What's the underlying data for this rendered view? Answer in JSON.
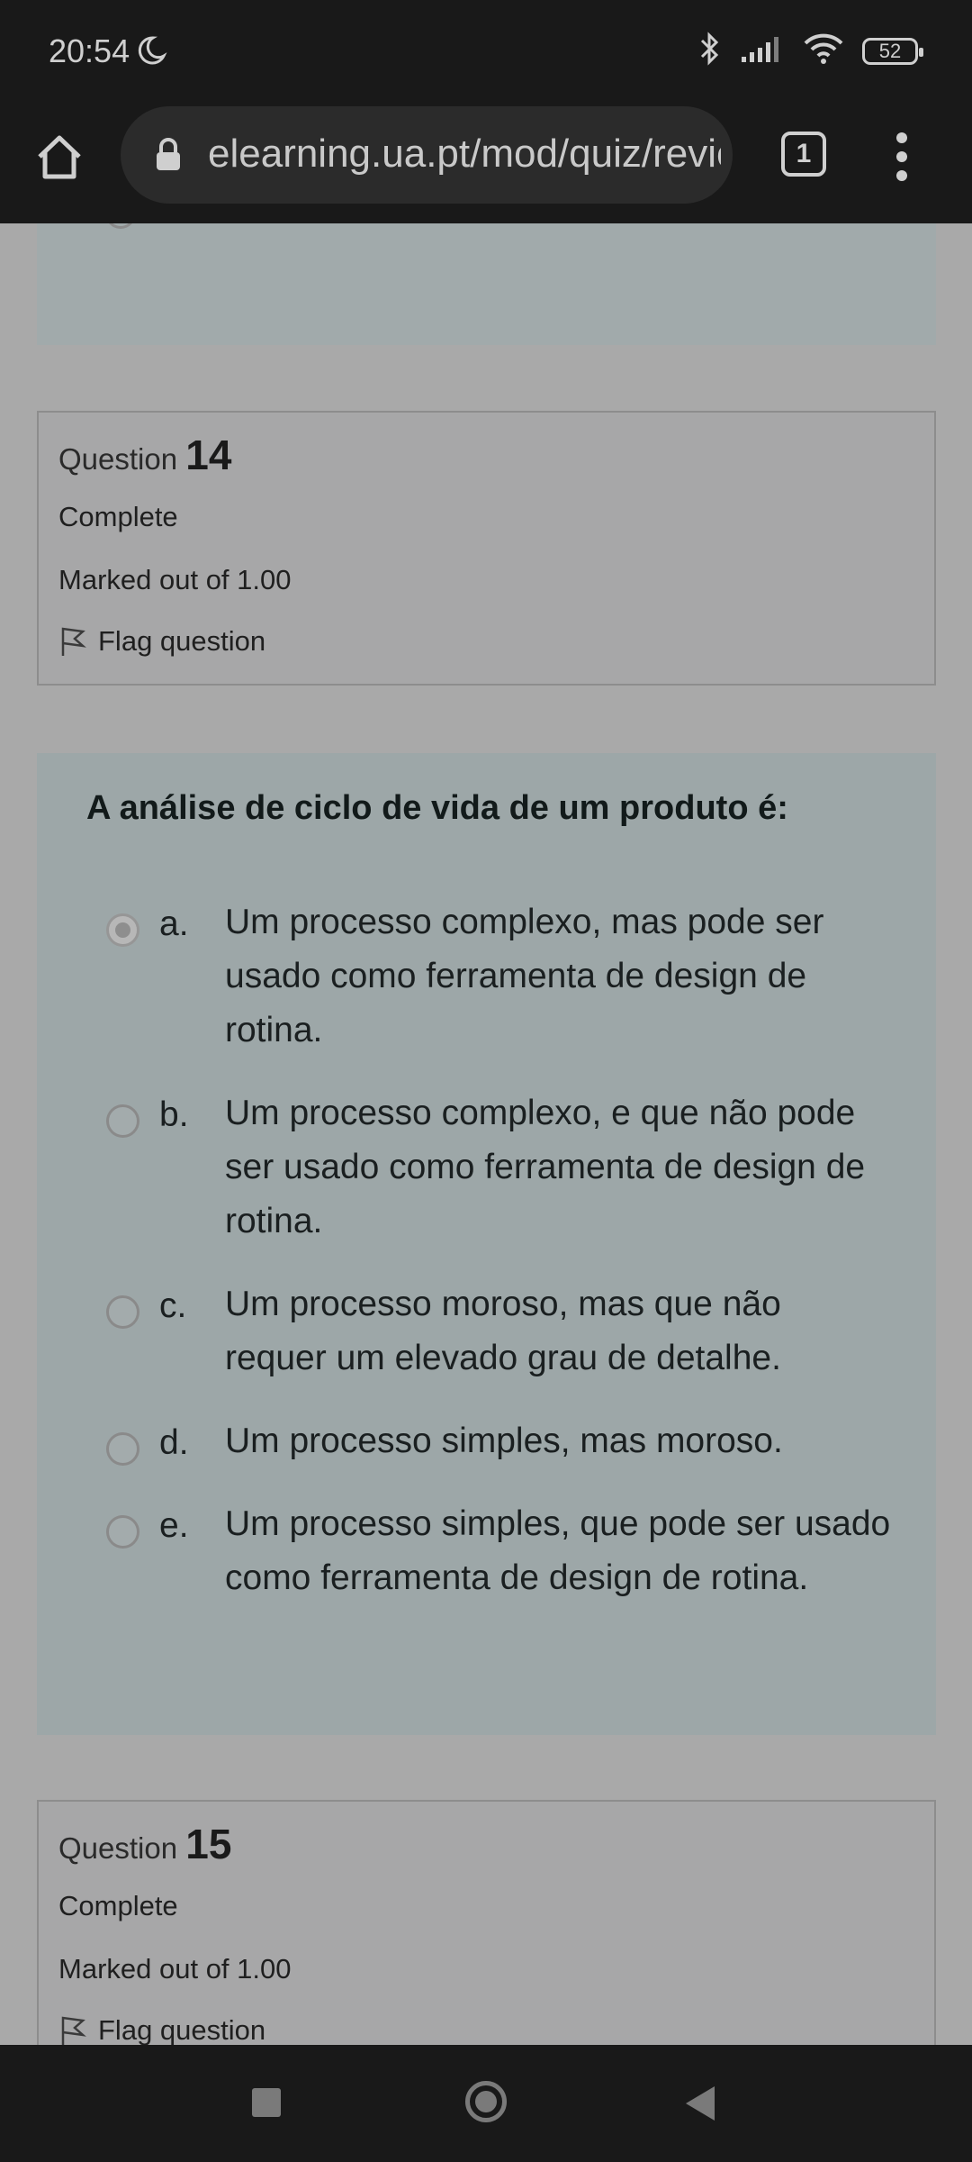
{
  "status_bar": {
    "time": "20:54",
    "battery": "52"
  },
  "browser": {
    "url": "elearning.ua.pt/mod/quiz/review.php",
    "tab_count": "1"
  },
  "question14": {
    "label": "Question",
    "number": "14",
    "state": "Complete",
    "mark": "Marked out of 1.00",
    "flag": "Flag question"
  },
  "quiz_question": {
    "text": "A análise de ciclo de vida de um produto é:",
    "selected": "a",
    "answers": [
      {
        "letter": "a.",
        "text": "Um processo complexo, mas pode ser usado como ferramenta de design de rotina."
      },
      {
        "letter": "b.",
        "text": "Um processo complexo, e que não pode ser usado como ferramenta de design de rotina."
      },
      {
        "letter": "c.",
        "text": "Um processo moroso, mas que não requer um elevado grau de detalhe."
      },
      {
        "letter": "d.",
        "text": "Um processo simples, mas moroso."
      },
      {
        "letter": "e.",
        "text": "Um processo simples, que pode ser usado como ferramenta de design de rotina."
      }
    ]
  },
  "question15": {
    "label": "Question",
    "number": "15",
    "state": "Complete",
    "mark": "Marked out of 1.00",
    "flag": "Flag question"
  }
}
